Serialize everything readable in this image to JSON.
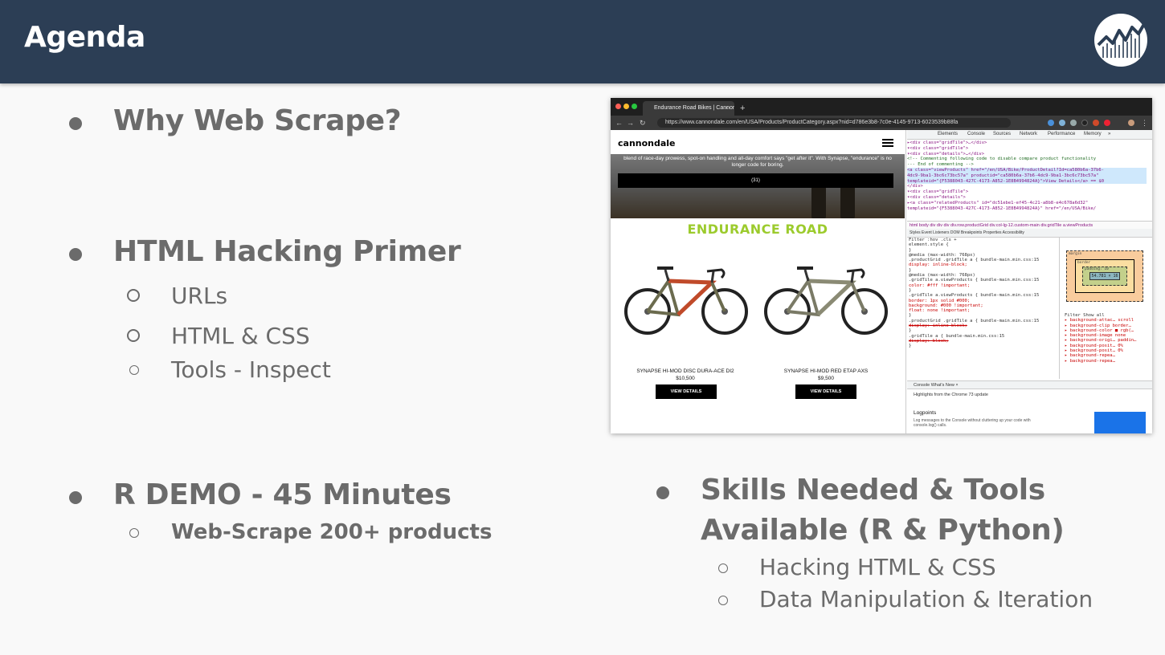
{
  "slide": {
    "title": "Agenda"
  },
  "sections": {
    "why": {
      "heading": "Why Web Scrape?"
    },
    "html_primer": {
      "heading": "HTML Hacking Primer",
      "items": [
        "URLs",
        "HTML & CSS",
        "Tools - Inspect"
      ]
    },
    "r_demo": {
      "heading": "R DEMO - 45 Minutes",
      "items": [
        "Web-Scrape 200+ products"
      ]
    },
    "skills": {
      "heading_line1": "Skills Needed & Tools",
      "heading_line2": "Available (R & Python)",
      "items": [
        "Hacking HTML & CSS",
        "Data Manipulation & Iteration"
      ]
    }
  },
  "screenshot": {
    "tab_title": "Endurance Road Bikes | Cannondale",
    "url": "https://www.cannondale.com/en/USA/Products/ProductCategory.aspx?nid=d786e3b8-7c0e-4145-9713-6023539b88fa",
    "site": {
      "brand": "cannondale",
      "hero_text": "blend of race-day prowess, spot-on handling and all-day comfort says \"get after it\". With Synapse, \"endurance\" is no longer code for boring.",
      "hero_button": "(31)",
      "category_title": "ENDURANCE ROAD",
      "products": [
        {
          "name": "SYNAPSE HI-MOD DISC DURA-ACE DI2",
          "price": "$10,500",
          "button": "VIEW DETAILS"
        },
        {
          "name": "SYNAPSE HI-MOD RED ETAP AXS",
          "price": "$9,500",
          "button": "VIEW DETAILS"
        }
      ]
    },
    "devtools": {
      "tabs": [
        "Elements",
        "Console",
        "Sources",
        "Network",
        "Performance",
        "Memory",
        "»"
      ],
      "code_lines": [
        "▸<div class=\"gridTile\">…</div>",
        "▾<div class=\"gridTile\">",
        "  ▾<div class=\"details\">…</div>",
        "    <!-- Commenting following code to disable compare product functionality",
        "         --- End of commenting -->",
        "  <a class=\"viewProducts\" href=\"/en/USA/Bike/ProductDetail?Id=ca580b6a-37b6-",
        "  4dc9-9ba1-3bc6c73bc57a\" productid=\"ca580b6a-37b6-4dc9-9ba1-3bc6c73bc57a\"",
        "  templateid=\"{F5388043-427C-4173-A852-1E8B4994824A}\">View Details</a> == $0",
        "</div>",
        "▾<div class=\"gridTile\">",
        "  ▾<div class=\"details\">",
        "    ▸<a class=\"relatedProducts\" id=\"dc51ebe1-ef45-4c21-a8b8-e4c678a6d32\"",
        "    templateid=\"{F5388043-427C-4173-A852-1E8B4994824A}\" href=\"/en/USA/Bike/"
      ],
      "breadcrumbs": "html  body  div  div  div  div.row.productGrid  div.col-lg-12.custom-main  div.gridTile  a.viewProducts",
      "sub_tabs": "Styles    Event Listeners    DOM Breakpoints    Properties    Accessibility",
      "style_lines": [
        "Filter                                              :hov  .cls  +",
        "element.style {",
        "}",
        "@media (max-width: 768px)",
        ".productGrid .gridTile a {          bundle-main.min.css:15",
        "  display: inline-block;",
        "}",
        "@media (max-width: 768px)",
        ".gridTile a.viewProducts {          bundle-main.min.css:15",
        "  color: #fff !important;",
        "}",
        ".gridTile a.viewProducts {          bundle-main.min.css:15",
        "  border: 1px solid #000;",
        "  background: #000 !important;",
        "  float: none !important;",
        "}",
        ".productGrid .gridTile a {          bundle-main.min.css:15",
        "  display: inline-block;",
        "}",
        ".gridTile a {                       bundle-main.min.css:15",
        "  display: block;",
        "}"
      ],
      "box_model": {
        "margin": "margin",
        "border": "border",
        "padding": "padding: 10",
        "content": "54.781 × 16"
      },
      "computed_lines": [
        "Filter               Show all",
        "▸ background-attac…  scroll",
        "▸ background-clip    border…",
        "▸ background-color   ■ rgb(…",
        "▸ background-image   none",
        "▸ background-origi…  paddin…",
        "▸ background-posit…  0%",
        "▸ background-posit…  0%",
        "▸ background-repea…",
        "▸ background-repea…"
      ],
      "drawer": {
        "tabs": "Console    What's New  ×",
        "heading": "Highlights from the Chrome 73 update",
        "section": "Logpoints",
        "text": "Log messages to the Console without cluttering up your code with console.log() calls."
      }
    }
  },
  "colors": {
    "header_bg": "#2c3e55",
    "text_gray": "#6b6b6b",
    "brand_green": "#9ccb2d"
  }
}
